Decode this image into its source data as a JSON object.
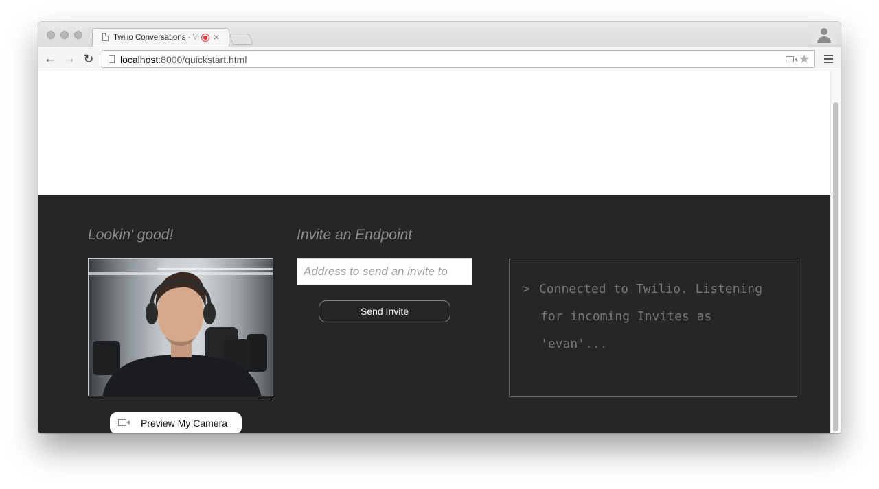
{
  "browser": {
    "tab_title": "Twilio Conversations - Video",
    "url_host": "localhost",
    "url_path": ":8000/quickstart.html",
    "icons": [
      "back-arrow-icon",
      "forward-arrow-icon",
      "reload-icon",
      "page-icon",
      "camera-icon",
      "star-icon",
      "menu-icon",
      "profile-icon",
      "record-icon",
      "close-icon"
    ],
    "recording_color": "#e33333"
  },
  "local_media": {
    "heading": "Lookin' good!",
    "preview_button_label": "Preview My Camera"
  },
  "invite": {
    "heading": "Invite an Endpoint",
    "placeholder": "Address to send an invite to",
    "value": "",
    "send_button_label": "Send Invite"
  },
  "log": {
    "prompt": ">",
    "lines": [
      "Connected to Twilio. Listening",
      "for incoming Invites as",
      "'evan'..."
    ]
  },
  "colors": {
    "dark_background": "#262626",
    "heading_text": "#8c8c8c",
    "log_text": "#777777"
  }
}
